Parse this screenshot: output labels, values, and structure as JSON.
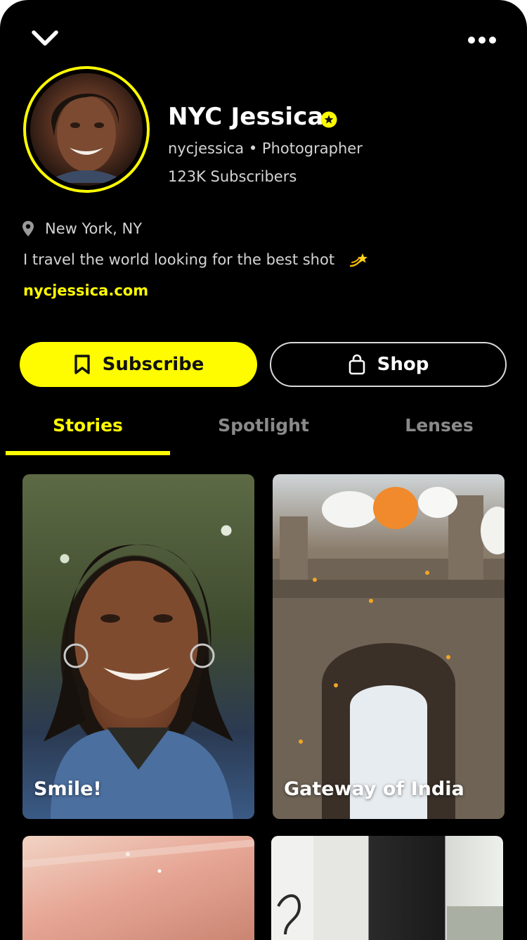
{
  "header": {
    "back_icon": "chevron-down-icon",
    "more_icon": "more-horizontal-icon"
  },
  "profile": {
    "display_name": "NYC Jessica",
    "verified_icon": "star-badge-icon",
    "handle_line": "nycjessica • Photographer",
    "subscribers": "123K Subscribers",
    "location_icon": "location-pin-icon",
    "location": "New York, NY",
    "bio": "I travel the world looking for the best shot",
    "bio_emoji_icon": "dizzy-star-emoji-icon",
    "website": "nycjessica.com"
  },
  "actions": {
    "subscribe_label": "Subscribe",
    "subscribe_icon": "bookmark-icon",
    "shop_label": "Shop",
    "shop_icon": "shopping-bag-icon"
  },
  "tabs": [
    {
      "label": "Stories",
      "active": true
    },
    {
      "label": "Spotlight",
      "active": false
    },
    {
      "label": "Lenses",
      "active": false
    }
  ],
  "stories": [
    {
      "title": "Smile!"
    },
    {
      "title": "Gateway of India"
    },
    {
      "title": ""
    },
    {
      "title": ""
    }
  ],
  "colors": {
    "accent": "#FFFC00",
    "background": "#000000",
    "muted_text": "#d4d4d4",
    "inactive_tab": "#8a8a8a"
  }
}
